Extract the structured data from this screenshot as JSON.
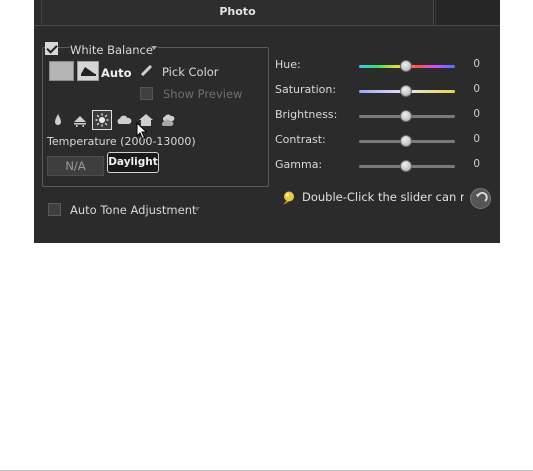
{
  "tab": {
    "label": "Photo"
  },
  "white_balance": {
    "enabled": true,
    "label": "White Balance",
    "auto_label": "Auto",
    "pick_color_label": "Pick Color",
    "show_preview_label": "Show Preview",
    "show_preview_checked": false,
    "presets": [
      "candle-icon",
      "fluorescent-icon",
      "daylight-icon",
      "cloudy-icon",
      "shade-icon",
      "overcast-icon"
    ],
    "selected_preset": "daylight-icon",
    "temperature_label": "Temperature (2000-13000)",
    "temperature_value": "N/A",
    "tooltip": "Daylight"
  },
  "auto_tone": {
    "label": "Auto Tone Adjustment",
    "checked": false
  },
  "sliders": [
    {
      "label": "Hue:",
      "value": "0",
      "position": 0.5,
      "track": "hue"
    },
    {
      "label": "Saturation:",
      "value": "0",
      "position": 0.5,
      "track": "saturation"
    },
    {
      "label": "Brightness:",
      "value": "0",
      "position": 0.5,
      "track": "plain"
    },
    {
      "label": "Contrast:",
      "value": "0",
      "position": 0.5,
      "track": "plain"
    },
    {
      "label": "Gamma:",
      "value": "0",
      "position": 0.5,
      "track": "plain"
    }
  ],
  "hint": {
    "text": "Double-Click the slider can reset"
  },
  "colors": {
    "panel_bg": "#2b2b2b",
    "text": "#d8d8d8",
    "accent_border": "#e0e0e0"
  }
}
